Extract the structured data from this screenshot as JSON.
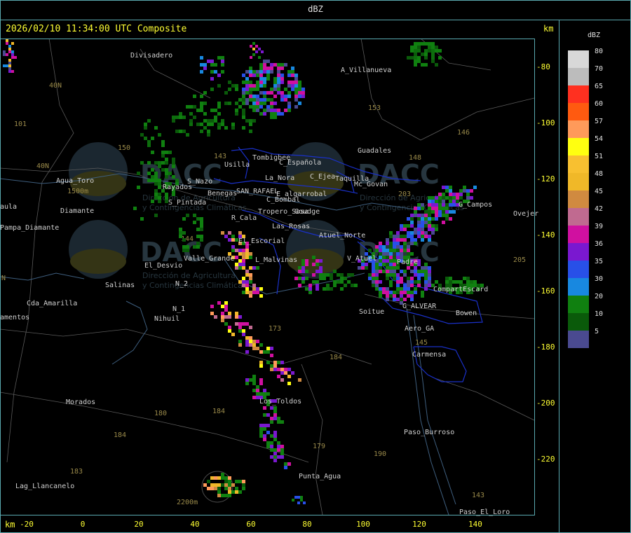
{
  "header": {
    "title": "dBZ"
  },
  "map": {
    "timestamp": "2026/02/10 11:34:00 UTC Composite",
    "axis_unit": "km",
    "y_ticks": [
      "-80",
      "-100",
      "-120",
      "-140",
      "-160",
      "-180",
      "-200",
      "-220"
    ],
    "x_ticks": [
      "-20",
      "0",
      "20",
      "40",
      "60",
      "80",
      "100",
      "120",
      "140"
    ],
    "places": [
      "Divisadero",
      "A_Villanueva",
      "Tombigbee",
      "Usilla",
      "C_Española",
      "C_Ejea",
      "La_Nora",
      "Rayados",
      "S_Nazo",
      "Benegas",
      "SAN_RAFAEL",
      "E_algarrobal",
      "S_Pintada",
      "C_Bombal",
      "Guadales",
      "Taquilla",
      "Mc_Govan",
      "G_Campos",
      "Ovejer",
      "Tropero_Sosa",
      "Goudge",
      "Agua_Toro",
      "Diamante",
      "Pampa_Diamante",
      "R_Cala",
      "Las_Rosas",
      "Atuel_Norte",
      "El_Escorial",
      "El_Desvio",
      "Valle_Grande",
      "L_Malvinas",
      "V_Atuel",
      "Salinas",
      "N_2",
      "Cda_Amarilla",
      "N_1",
      "Nihuil",
      "Soitue",
      "G_ALVEAR",
      "CompartEscard",
      "Bowen",
      "Aero_GA",
      "Carmensa",
      "Los_Toldos",
      "Morados",
      "Paso_Burroso",
      "Punta_Agua",
      "Lag_Llancanelo",
      "Paso_El_Loro",
      "amentos",
      "aula",
      "Padre"
    ],
    "routes": [
      "101",
      "40N",
      "40N",
      "150",
      "153",
      "146",
      "143",
      "203",
      "144",
      "173",
      "184",
      "180",
      "184",
      "184",
      "183",
      "179",
      "190",
      "145",
      "143",
      "205",
      "148",
      "N"
    ],
    "elevations": [
      "1500m",
      "2200m"
    ],
    "watermark": {
      "brand": "DACC",
      "lines": [
        "Dirección de Agricultura",
        "y Contingencias Climáticas"
      ]
    }
  },
  "legend": {
    "title": "dBZ",
    "scale": [
      {
        "value": "80",
        "color": "#d8d8d8"
      },
      {
        "value": "70",
        "color": "#bcbcbc"
      },
      {
        "value": "65",
        "color": "#ff3020"
      },
      {
        "value": "60",
        "color": "#ff5a10"
      },
      {
        "value": "57",
        "color": "#ff9a5a"
      },
      {
        "value": "54",
        "color": "#ffff10"
      },
      {
        "value": "51",
        "color": "#f8c030"
      },
      {
        "value": "48",
        "color": "#f0b828"
      },
      {
        "value": "45",
        "color": "#d08a40"
      },
      {
        "value": "42",
        "color": "#c06a90"
      },
      {
        "value": "39",
        "color": "#d010a0"
      },
      {
        "value": "36",
        "color": "#7a18d0"
      },
      {
        "value": "35",
        "color": "#2850e8"
      },
      {
        "value": "30",
        "color": "#1888e0"
      },
      {
        "value": "20",
        "color": "#108010"
      },
      {
        "value": "10",
        "color": "#0a5a0a"
      },
      {
        "value": "5",
        "color": "#4a4a90"
      }
    ]
  }
}
